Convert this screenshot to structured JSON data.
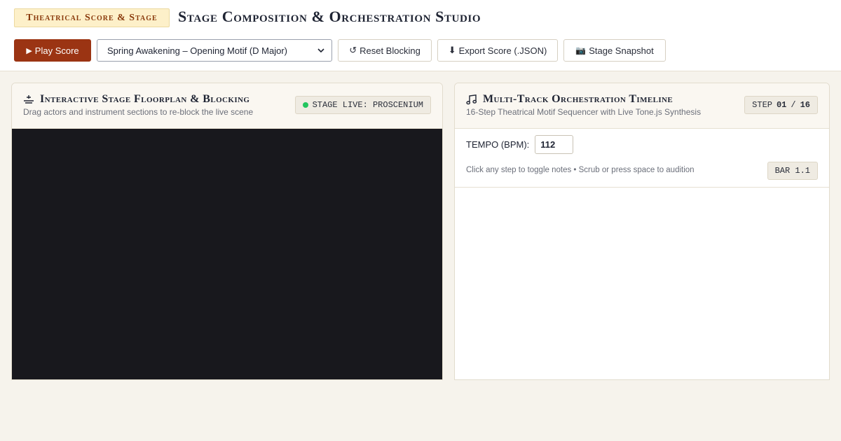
{
  "header": {
    "badge": "Theatrical Score & Stage",
    "title": "Stage Composition & Orchestration Studio"
  },
  "toolbar": {
    "play_label": "Play Score",
    "play_icon": "▶",
    "score_select": {
      "selected": "Spring Awakening – Opening Motif (D Major)"
    },
    "reset_label": "Reset Blocking",
    "reset_icon": "↺",
    "export_label": "Export Score (.JSON)",
    "export_icon": "⬇",
    "snapshot_label": "Stage Snapshot",
    "snapshot_icon": "📷"
  },
  "stage_panel": {
    "title": "Interactive Stage Floorplan & Blocking",
    "subtitle": "Drag actors and instrument sections to re-block the live scene",
    "status": "STAGE LIVE: PROSCENIUM",
    "status_color": "#22c55e"
  },
  "timeline_panel": {
    "title": "Multi-Track Orchestration Timeline",
    "subtitle": "16-Step Theatrical Motif Sequencer with Live Tone.js Synthesis",
    "step_label": "STEP",
    "step_current": "01",
    "step_total": "16",
    "tempo_label": "TEMPO (BPM):",
    "tempo_value": "112",
    "hint": "Click any step to toggle notes • Scrub or press space to audition",
    "bar_label": "BAR 1.1"
  },
  "colors": {
    "accent": "#9b3413",
    "badge_bg": "#fdf0c9",
    "stage_bg": "#18181d",
    "page_bg": "#f6f3ec"
  }
}
